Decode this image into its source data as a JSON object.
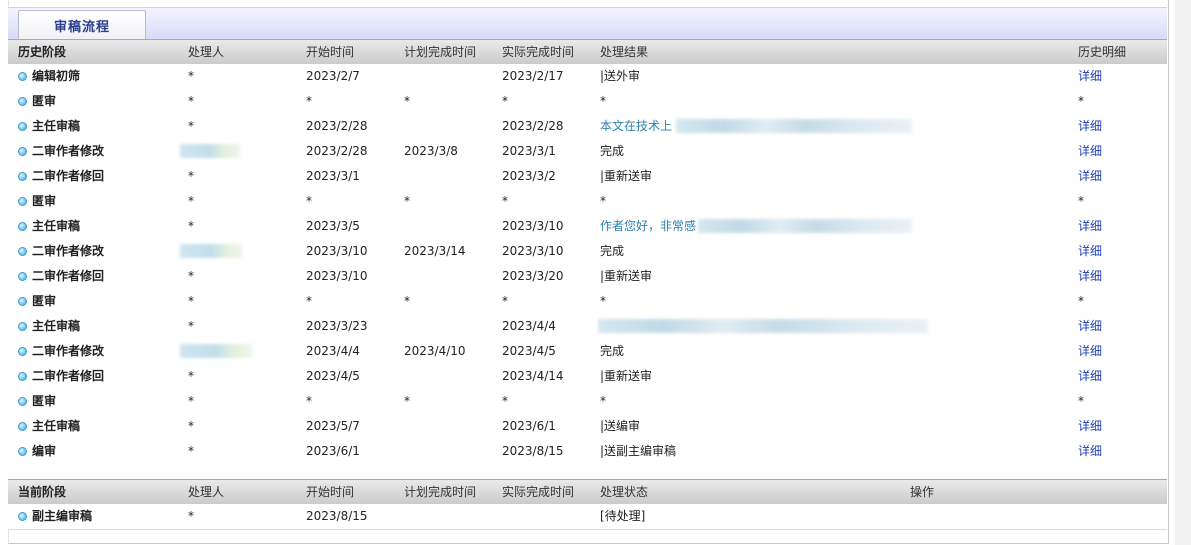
{
  "tab": {
    "label": "审稿流程"
  },
  "history": {
    "headers": [
      "历史阶段",
      "处理人",
      "开始时间",
      "计划完成时间",
      "实际完成时间",
      "处理结果",
      "历史明细"
    ],
    "rows": [
      {
        "stage": "编辑初筛",
        "handler": "*",
        "start": "2023/2/7",
        "planned": "",
        "actual": "2023/2/17",
        "result": "|送外审",
        "detail": "详细"
      },
      {
        "stage": "匿审",
        "handler": "*",
        "start": "*",
        "planned": "*",
        "actual": "*",
        "result": "*",
        "detail": "*"
      },
      {
        "stage": "主任审稿",
        "handler": "*",
        "start": "2023/2/28",
        "planned": "",
        "actual": "2023/2/28",
        "result": "本文在技术上",
        "detail": "详细"
      },
      {
        "stage": "二审作者修改",
        "handler": "",
        "start": "2023/2/28",
        "planned": "2023/3/8",
        "actual": "2023/3/1",
        "result": "完成",
        "detail": "详细"
      },
      {
        "stage": "二审作者修回",
        "handler": "*",
        "start": "2023/3/1",
        "planned": "",
        "actual": "2023/3/2",
        "result": "|重新送审",
        "detail": "详细"
      },
      {
        "stage": "匿审",
        "handler": "*",
        "start": "*",
        "planned": "*",
        "actual": "*",
        "result": "*",
        "detail": "*"
      },
      {
        "stage": "主任审稿",
        "handler": "*",
        "start": "2023/3/5",
        "planned": "",
        "actual": "2023/3/10",
        "result": "作者您好，非常感",
        "detail": "详细"
      },
      {
        "stage": "二审作者修改",
        "handler": "",
        "start": "2023/3/10",
        "planned": "2023/3/14",
        "actual": "2023/3/10",
        "result": "完成",
        "detail": "详细"
      },
      {
        "stage": "二审作者修回",
        "handler": "*",
        "start": "2023/3/10",
        "planned": "",
        "actual": "2023/3/20",
        "result": "|重新送审",
        "detail": "详细"
      },
      {
        "stage": "匿审",
        "handler": "*",
        "start": "*",
        "planned": "*",
        "actual": "*",
        "result": "*",
        "detail": "*"
      },
      {
        "stage": "主任审稿",
        "handler": "*",
        "start": "2023/3/23",
        "planned": "",
        "actual": "2023/4/4",
        "result": "",
        "detail": "详细"
      },
      {
        "stage": "二审作者修改",
        "handler": "",
        "start": "2023/4/4",
        "planned": "2023/4/10",
        "actual": "2023/4/5",
        "result": "完成",
        "detail": "详细"
      },
      {
        "stage": "二审作者修回",
        "handler": "*",
        "start": "2023/4/5",
        "planned": "",
        "actual": "2023/4/14",
        "result": "|重新送审",
        "detail": "详细"
      },
      {
        "stage": "匿审",
        "handler": "*",
        "start": "*",
        "planned": "*",
        "actual": "*",
        "result": "*",
        "detail": "*"
      },
      {
        "stage": "主任审稿",
        "handler": "*",
        "start": "2023/5/7",
        "planned": "",
        "actual": "2023/6/1",
        "result": "|送编审",
        "detail": "详细"
      },
      {
        "stage": "编审",
        "handler": "*",
        "start": "2023/6/1",
        "planned": "",
        "actual": "2023/8/15",
        "result": "|送副主编审稿",
        "detail": "详细"
      }
    ]
  },
  "current": {
    "headers": [
      "当前阶段",
      "处理人",
      "开始时间",
      "计划完成时间",
      "实际完成时间",
      "处理状态",
      "操作"
    ],
    "rows": [
      {
        "stage": "副主编审稿",
        "handler": "*",
        "start": "2023/8/15",
        "planned": "",
        "actual": "",
        "status": "[待处理]",
        "op": ""
      }
    ]
  }
}
